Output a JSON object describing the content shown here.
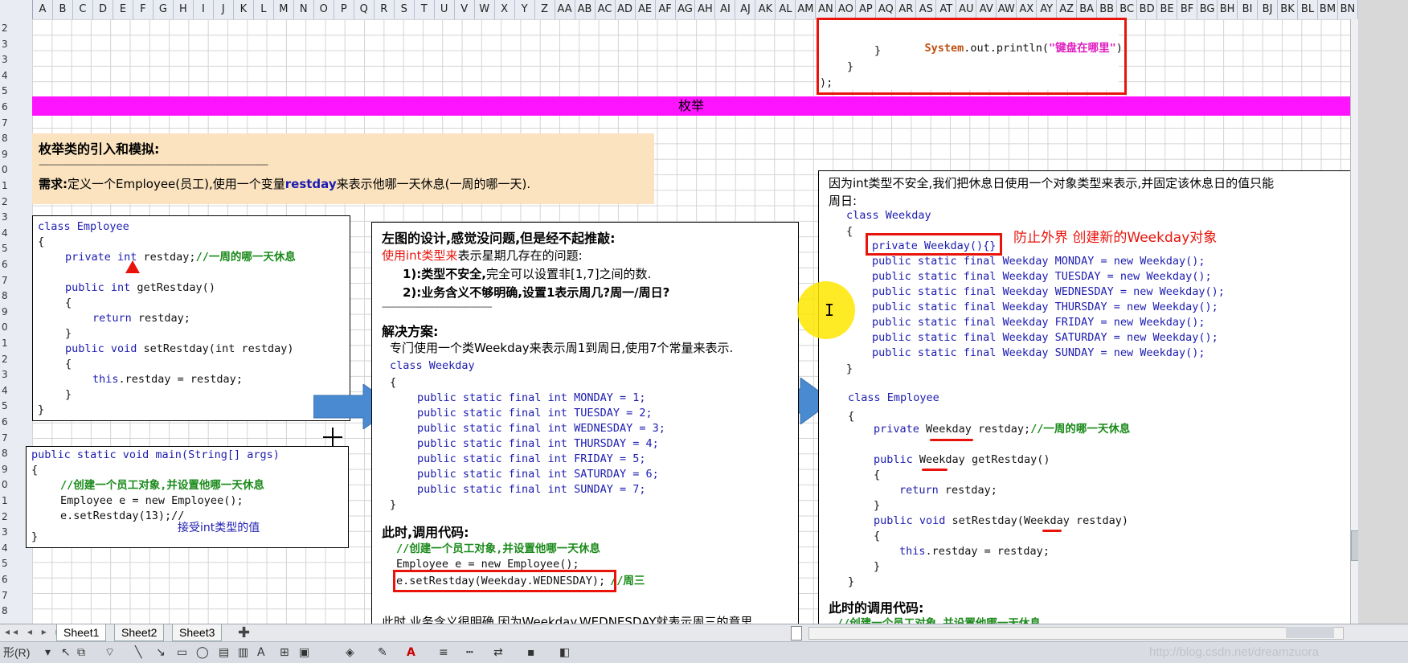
{
  "columns": [
    "A",
    "B",
    "C",
    "D",
    "E",
    "F",
    "G",
    "H",
    "I",
    "J",
    "K",
    "L",
    "M",
    "N",
    "O",
    "P",
    "Q",
    "R",
    "S",
    "T",
    "U",
    "V",
    "W",
    "X",
    "Y",
    "Z",
    "AA",
    "AB",
    "AC",
    "AD",
    "AE",
    "AF",
    "AG",
    "AH",
    "AI",
    "AJ",
    "AK",
    "AL",
    "AM",
    "AN",
    "AO",
    "AP",
    "AQ",
    "AR",
    "AS",
    "AT",
    "AU",
    "AV",
    "AW",
    "AX",
    "AY",
    "AZ",
    "BA",
    "BB",
    "BC",
    "BD",
    "BE",
    "BF",
    "BG",
    "BH",
    "BI",
    "BJ",
    "BK",
    "BL",
    "BM",
    "BN"
  ],
  "rows": [
    "2",
    "3",
    "3",
    "4",
    "5",
    "6",
    "7",
    "8",
    "9",
    "0",
    "1",
    "2",
    "3",
    "4",
    "5",
    "6",
    "7",
    "8",
    "9",
    "0",
    "1",
    "2",
    "3",
    "4",
    "5",
    "6",
    "7",
    "8",
    "9",
    "0",
    "1",
    "2",
    "3",
    "4",
    "5",
    "6",
    "7",
    "8"
  ],
  "banner": {
    "title": "枚举",
    "color": "#ff14ff"
  },
  "top_code": {
    "line1_obj": "System",
    "line1_mid": ".out.println(",
    "line1_str": "\"键盘在哪里\"",
    "line1_end": ");",
    "line2": "}",
    "line3": "}",
    "line4": ");"
  },
  "intro": {
    "title": "枚举类的引入和模拟:",
    "dashes": "------------------------------------------------------------------------------------------------",
    "req_label": "需求:",
    "req_a": "定义一个Employee(员工),使用一个变量",
    "req_var": "restday",
    "req_b": "来表示他哪一天休息(一周的哪一天)."
  },
  "emp1": {
    "l1": "class Employee",
    "l2": "{",
    "l3_kw": "private int",
    "l3_var": " restday;",
    "l3_cm": "//一周的哪一天休息",
    "l4_kw": "public int",
    "l4_rest": " getRestday()",
    "l5": "{",
    "l6_kw": "return",
    "l6_rest": " restday;",
    "l7": "}",
    "l8_kw": "public void",
    "l8_rest": " setRestday(int restday)",
    "l9": "{",
    "l10_kw": "this",
    "l10_rest": ".restday = restday;",
    "l11": "}",
    "l12": "}"
  },
  "main1": {
    "l1": "public static void main(String[] args)",
    "l2": "{",
    "l3": "//创建一个员工对象,并设置他哪一天休息",
    "l4": "Employee e = new Employee();",
    "l5": "e.setRestday(13);//",
    "l6": "接受int类型的值",
    "l7": "}"
  },
  "mid": {
    "title": "左图的设计,感觉没问题,但是经不起推敲:",
    "p1_red": "使用int类型来",
    "p1_rest": "表示星期几存在的问题:",
    "p2": "1):类型不安全,",
    "p2b": "完全可以设置非[1,7]之间的数.",
    "p3": "2):业务含义不够明确,设置1表示周几?周一/周日?",
    "dashes": "----------------------------------------------",
    "sol_title": "解决方案:",
    "sol_text": "专门使用一个类Weekday来表示周1到周日,使用7个常量来表示.",
    "cls": "class Weekday",
    "open": "{",
    "consts": [
      "public static final int MONDAY = 1;",
      "public static final int TUESDAY = 2;",
      "public static final int WEDNESDAY = 3;",
      "public static final int THURSDAY = 4;",
      "public static final int FRIDAY = 5;",
      "public static final int SATURDAY = 6;",
      "public static final int SUNDAY = 7;"
    ],
    "close": "}",
    "call_title": "此时,调用代码:",
    "call_cm": "//创建一个员工对象,并设置他哪一天休息",
    "call_l1": "Employee e = new Employee();",
    "call_l2": "e.setRestday(Weekday.WEDNESDAY);",
    "call_l2_cm": "//周三",
    "bottom": "此时,业务含义很明确,因为Weekday.WEDNESDAY就表示周三的意思."
  },
  "right": {
    "intro1": "因为int类型不安全,我们把休息日使用一个对象类型来表示,并固定该休息日的值只能",
    "intro2": "周日:",
    "cls": "class Weekday",
    "open": "{",
    "ctor": "private Weekday(){}",
    "ctor_note": "防止外界 创建新的Weekday对象",
    "consts": [
      "public static final Weekday MONDAY = new Weekday();",
      "public static final Weekday TUESDAY = new Weekday();",
      "public static final Weekday WEDNESDAY = new Weekday();",
      "public static final Weekday THURSDAY = new Weekday();",
      "public static final Weekday FRIDAY = new Weekday();",
      "public static final Weekday SATURDAY = new Weekday();",
      "public static final Weekday SUNDAY = new Weekday();"
    ],
    "close": "}",
    "emp_cls": "class Employee",
    "emp_open": "{",
    "emp_l1_kw": "private",
    "emp_l1_t": " Weekday",
    "emp_l1_v": " restday;",
    "emp_l1_cm": "//一周的哪一天休息",
    "emp_l2_kw": "public",
    "emp_l2_t": " Weekday",
    "emp_l2_rest": " getRestday()",
    "emp_l3": "{",
    "emp_l4_kw": "return",
    "emp_l4_rest": " restday;",
    "emp_l5": "}",
    "emp_l6_kw": "public void",
    "emp_l6_rest": " setRestday(",
    "emp_l6_t": "Weekday",
    "emp_l6_end": " restday)",
    "emp_l7": "{",
    "emp_l8_kw": "this",
    "emp_l8_rest": ".restday = restday;",
    "emp_l9": "}",
    "emp_close": "}",
    "call_title": "此时的调用代码:",
    "call_cm": "//创建一个员工对象,并设置他哪一天休息"
  },
  "sheets": [
    "Sheet1",
    "Sheet2",
    "Sheet3"
  ],
  "toolbar": {
    "draw_label": "形(R)"
  },
  "watermark": "http://blog.csdn.net/dreamzuora"
}
